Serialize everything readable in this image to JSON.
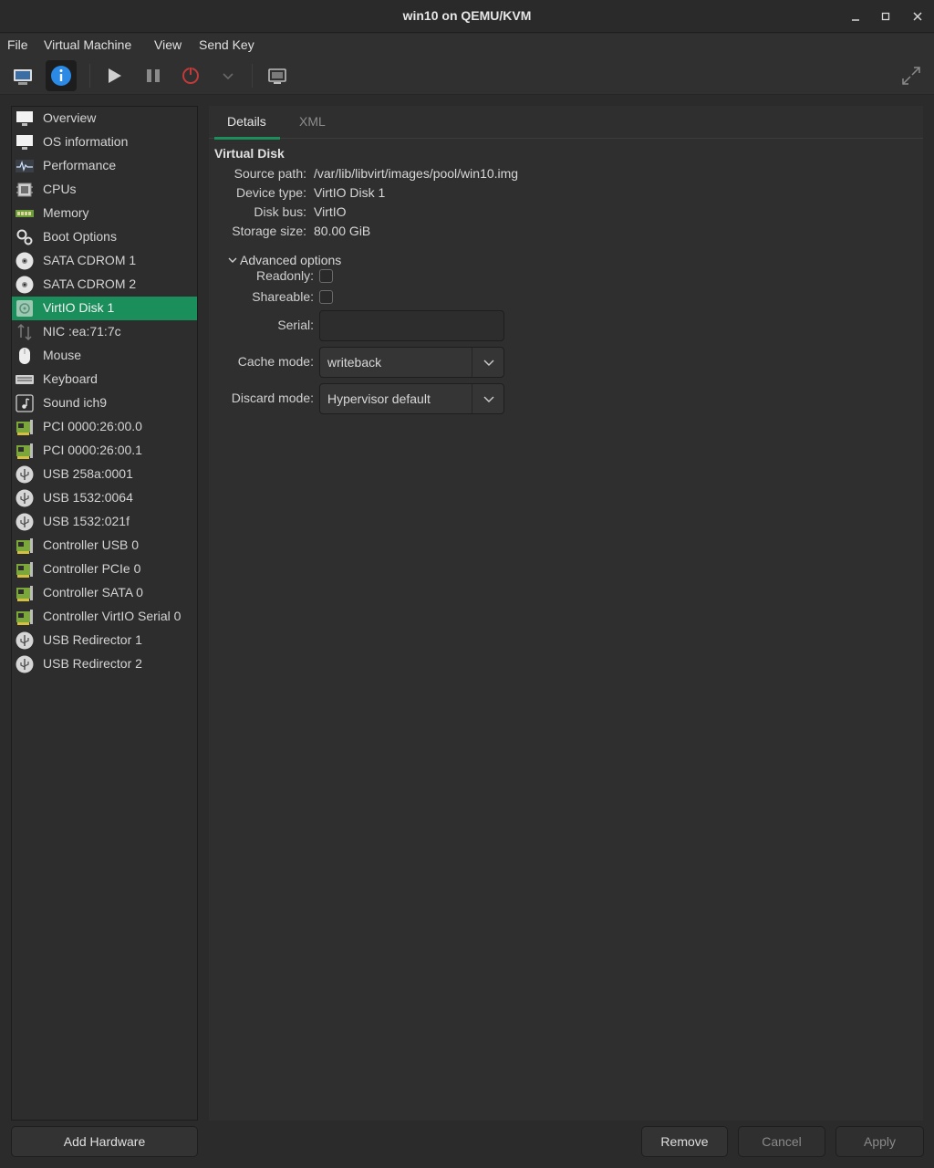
{
  "window": {
    "title": "win10 on QEMU/KVM"
  },
  "menu": [
    "File",
    "Virtual Machine",
    "View",
    "Send Key"
  ],
  "toolbar": {
    "buttons": [
      "monitor-icon",
      "info-icon",
      "play-icon",
      "pause-icon",
      "power-icon",
      "chevron-down-icon",
      "screenshot-icon",
      "fullscreen-icon"
    ],
    "accent_color": "#2b8ae6",
    "power_color": "#c23a3a"
  },
  "sidebar": {
    "selected_color": "#1a8f5c",
    "items": [
      {
        "label": "Overview",
        "icon": "monitor-icon"
      },
      {
        "label": "OS information",
        "icon": "monitor-icon"
      },
      {
        "label": "Performance",
        "icon": "chart-icon"
      },
      {
        "label": "CPUs",
        "icon": "cpu-icon"
      },
      {
        "label": "Memory",
        "icon": "memory-icon"
      },
      {
        "label": "Boot Options",
        "icon": "gears-icon"
      },
      {
        "label": "SATA CDROM 1",
        "icon": "cdrom-icon"
      },
      {
        "label": "SATA CDROM 2",
        "icon": "cdrom-icon"
      },
      {
        "label": "VirtIO Disk 1",
        "icon": "disk-icon",
        "selected": true
      },
      {
        "label": "NIC :ea:71:7c",
        "icon": "network-icon"
      },
      {
        "label": "Mouse",
        "icon": "mouse-icon"
      },
      {
        "label": "Keyboard",
        "icon": "keyboard-icon"
      },
      {
        "label": "Sound ich9",
        "icon": "sound-icon"
      },
      {
        "label": "PCI 0000:26:00.0",
        "icon": "pci-card-icon"
      },
      {
        "label": "PCI 0000:26:00.1",
        "icon": "pci-card-icon"
      },
      {
        "label": "USB 258a:0001",
        "icon": "usb-icon"
      },
      {
        "label": "USB 1532:0064",
        "icon": "usb-icon"
      },
      {
        "label": "USB 1532:021f",
        "icon": "usb-icon"
      },
      {
        "label": "Controller USB 0",
        "icon": "pci-card-icon"
      },
      {
        "label": "Controller PCIe 0",
        "icon": "pci-card-icon"
      },
      {
        "label": "Controller SATA 0",
        "icon": "pci-card-icon"
      },
      {
        "label": "Controller VirtIO Serial 0",
        "icon": "pci-card-icon"
      },
      {
        "label": "USB Redirector 1",
        "icon": "usb-icon"
      },
      {
        "label": "USB Redirector 2",
        "icon": "usb-icon"
      }
    ]
  },
  "tabs": {
    "details": "Details",
    "xml": "XML"
  },
  "details": {
    "section_title": "Virtual Disk",
    "source_path_label": "Source path:",
    "source_path": "/var/lib/libvirt/images/pool/win10.img",
    "device_type_label": "Device type:",
    "device_type": "VirtIO Disk 1",
    "disk_bus_label": "Disk bus:",
    "disk_bus": "VirtIO",
    "storage_size_label": "Storage size:",
    "storage_size": "80.00 GiB",
    "advanced_label": "Advanced options",
    "readonly_label": "Readonly:",
    "readonly_checked": false,
    "shareable_label": "Shareable:",
    "shareable_checked": false,
    "serial_label": "Serial:",
    "serial_value": "",
    "cache_mode_label": "Cache mode:",
    "cache_mode": "writeback",
    "discard_mode_label": "Discard mode:",
    "discard_mode": "Hypervisor default"
  },
  "buttons": {
    "add_hardware": "Add Hardware",
    "remove": "Remove",
    "cancel": "Cancel",
    "apply": "Apply"
  }
}
